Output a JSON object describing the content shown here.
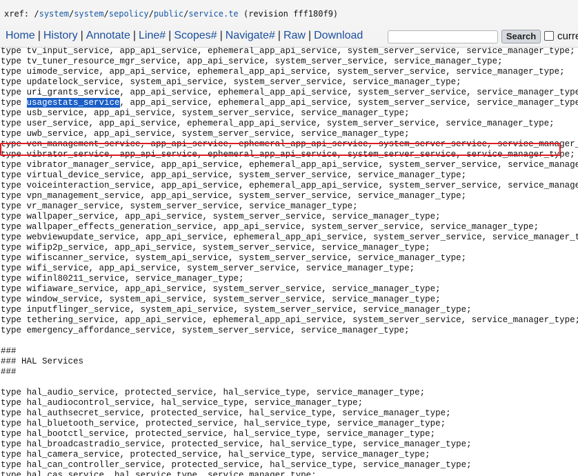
{
  "breadcrumb": {
    "prefix": "xref: ",
    "root_sep": "/",
    "segments": [
      "system",
      "system",
      "sepolicy",
      "public",
      "service.te"
    ],
    "revision": " (revision fff180f9)"
  },
  "nav": {
    "links": [
      "Home",
      "History",
      "Annotate",
      "Line#",
      "Scopes#",
      "Navigate#",
      "Raw",
      "Download"
    ],
    "search_placeholder": "",
    "search_button": "Search",
    "current_dir_label": "curre"
  },
  "code": {
    "lines": [
      "type tv_input_service, app_api_service, ephemeral_app_api_service, system_server_service, service_manager_type;",
      "type tv_tuner_resource_mgr_service, app_api_service, system_server_service, service_manager_type;",
      "type uimode_service, app_api_service, ephemeral_app_api_service, system_server_service, service_manager_type;",
      "type updatelock_service, system_api_service, system_server_service, service_manager_type;",
      "type uri_grants_service, app_api_service, ephemeral_app_api_service, system_server_service, service_manager_type;",
      "type usagestats_service, app_api_service, ephemeral_app_api_service, system_server_service, service_manager_type;",
      "type usb_service, app_api_service, system_server_service, service_manager_type;",
      "type user_service, app_api_service, ephemeral_app_api_service, system_server_service, service_manager_type;",
      "type uwb_service, app_api_service, system_server_service, service_manager_type;",
      "type vcn_management_service, app_api_service, ephemeral_app_api_service, system_server_service, service_manager_type;",
      "type vibrator_service, app_api_service, ephemeral_app_api_service, system_server_service, service_manager_type;",
      "type vibrator_manager_service, app_api_service, ephemeral_app_api_service, system_server_service, service_manager_type;",
      "type virtual_device_service, app_api_service, system_server_service, service_manager_type;",
      "type voiceinteraction_service, app_api_service, ephemeral_app_api_service, system_server_service, service_manager_type;",
      "type vpn_management_service, app_api_service, system_server_service, service_manager_type;",
      "type vr_manager_service, system_server_service, service_manager_type;",
      "type wallpaper_service, app_api_service, system_server_service, service_manager_type;",
      "type wallpaper_effects_generation_service, app_api_service, system_server_service, service_manager_type;",
      "type webviewupdate_service, app_api_service, ephemeral_app_api_service, system_server_service, service_manager_type;",
      "type wifip2p_service, app_api_service, system_server_service, service_manager_type;",
      "type wifiscanner_service, system_api_service, system_server_service, service_manager_type;",
      "type wifi_service, app_api_service, system_server_service, service_manager_type;",
      "type wifinl80211_service, service_manager_type;",
      "type wifiaware_service, app_api_service, system_server_service, service_manager_type;",
      "type window_service, system_api_service, system_server_service, service_manager_type;",
      "type inputflinger_service, system_api_service, system_server_service, service_manager_type;",
      "type tethering_service, app_api_service, ephemeral_app_api_service, system_server_service, service_manager_type;",
      "type emergency_affordance_service, system_server_service, service_manager_type;",
      "",
      "###",
      "### HAL Services",
      "###",
      "",
      "type hal_audio_service, protected_service, hal_service_type, service_manager_type;",
      "type hal_audiocontrol_service, hal_service_type, service_manager_type;",
      "type hal_authsecret_service, protected_service, hal_service_type, service_manager_type;",
      "type hal_bluetooth_service, protected_service, hal_service_type, service_manager_type;",
      "type hal_bootctl_service, protected_service, hal_service_type, service_manager_type;",
      "type hal_broadcastradio_service, protected_service, hal_service_type, service_manager_type;",
      "type hal_camera_service, protected_service, hal_service_type, service_manager_type;",
      "type hal_can_controller_service, protected_service, hal_service_type, service_manager_type;",
      "type hal_cas_service, hal_service_type, service_manager_type;"
    ],
    "highlight": {
      "line_index": 5,
      "prefix": "type ",
      "selected": "usagestats_service",
      "suffix": ", app_api_service, ephemeral_app_api_service, system_server_service, service_manager_type;"
    }
  },
  "colors": {
    "selection": "#1b5fc7",
    "annotation_box": "#e01b24",
    "link": "#1a4f9c"
  }
}
